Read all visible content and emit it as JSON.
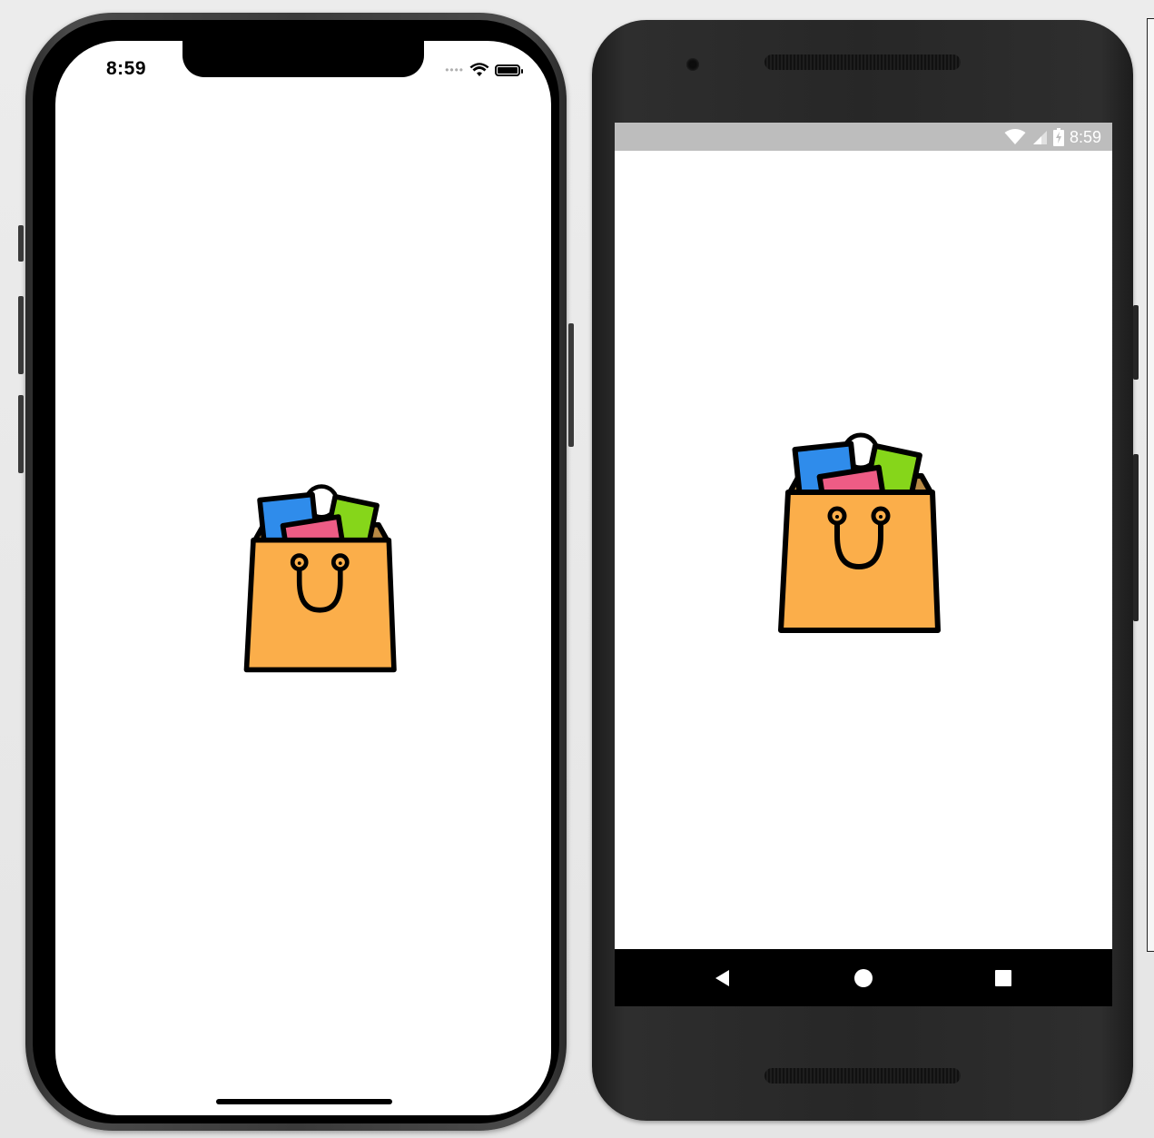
{
  "ios": {
    "status_time": "8:59",
    "signal": "••••",
    "icons": [
      "wifi-icon",
      "battery-icon"
    ]
  },
  "android": {
    "status_time": "8:59",
    "icons": [
      "wifi-icon",
      "cell-signal-icon",
      "battery-charging-icon"
    ],
    "nav": [
      "back-button",
      "home-button",
      "recents-button"
    ]
  },
  "splash": {
    "logo": "shopping-bag-icon",
    "colors": {
      "bag": "#FBAE4A",
      "outline": "#000000",
      "card_blue": "#2F8CEB",
      "card_pink": "#EE5C85",
      "card_green": "#86D61A",
      "bag_inside": "#B98A45"
    }
  }
}
